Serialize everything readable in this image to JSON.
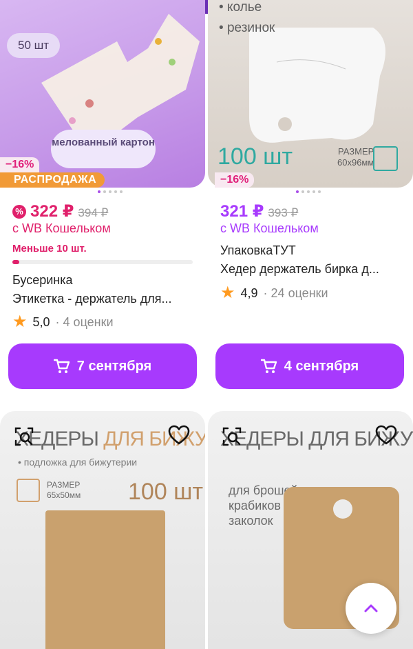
{
  "products": [
    {
      "photo": {
        "qty_badge": "50 шт",
        "material": "мелованный картон"
      },
      "discount": "−16%",
      "sale_label": "РАСПРОДАЖА",
      "promo_icon": "percent-badge-icon",
      "price": "322 ₽",
      "old_price": "394 ₽",
      "wallet": "с WB Кошельком",
      "stock_note": "Меньше 10 шт.",
      "stock_level": 0.04,
      "brand": "Бусеринка",
      "title": "Этикетка - держатель для...",
      "rating": "5,0",
      "reviews": "· 4 оценки",
      "delivery": "7 сентября"
    },
    {
      "photo": {
        "list": [
          "колье",
          "резинок"
        ],
        "qty_label": "100 шт",
        "size_label": "РАЗМЕР",
        "size_value": "60x96мм"
      },
      "discount": "−16%",
      "price": "321 ₽",
      "old_price": "393 ₽",
      "wallet": "с WB Кошельком",
      "brand": "УпаковкаТУТ",
      "title": "Хедер держатель бирка д...",
      "rating": "4,9",
      "reviews": "· 24 оценки",
      "delivery": "4 сентября"
    }
  ],
  "next_row": [
    {
      "photo": {
        "title_a": "ХЕДЕРЫ ",
        "title_b": "ДЛЯ БИЖУТЕРИИ",
        "subtitle": "• подложка для бижутерии",
        "size_label": "РАЗМЕР",
        "size_value": "65x50мм",
        "qty_label": "100 шт"
      }
    },
    {
      "photo": {
        "title_a": "ХЕДЕРЫ ДЛЯ БИЖУТЕРИИ",
        "list": [
          "для брошей",
          "крабиков",
          "заколок"
        ]
      }
    }
  ],
  "icons": {
    "cart": "cart-icon",
    "star": "star-icon",
    "search_similar": "search-similar-icon",
    "favorite": "heart-icon",
    "scroll_top": "chevron-up-icon"
  },
  "colors": {
    "accent": "#a73afd",
    "price_red": "#e0206b",
    "sale_orange": "#f19a37",
    "star": "#ff9a1f",
    "top_bar": "#6b2fb5"
  }
}
